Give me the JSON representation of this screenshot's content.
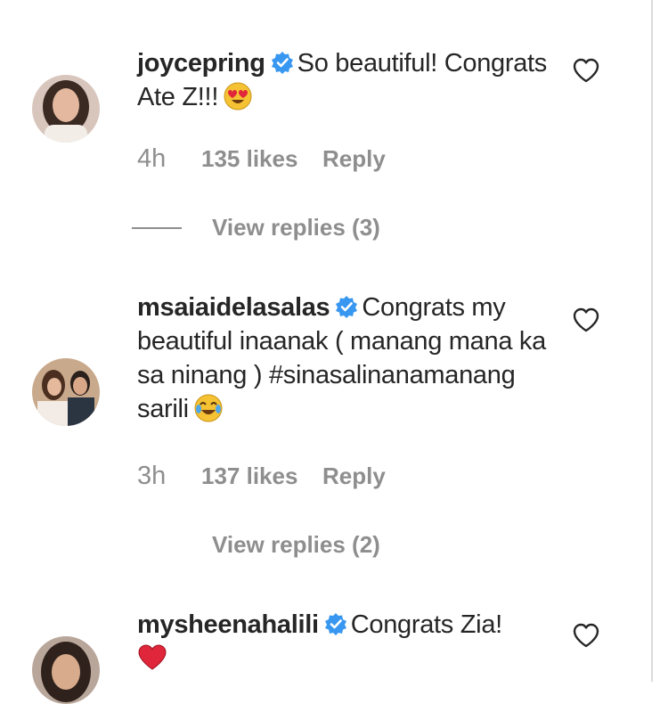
{
  "comments": [
    {
      "username": "joycepring",
      "verified": true,
      "text": "So beautiful! Congrats Ate Z!!!",
      "emoji": "heart-eyes-emoji",
      "time": "4h",
      "likes": "135 likes",
      "reply_label": "Reply",
      "view_replies": "View replies (3)"
    },
    {
      "username": "msaiaidelasalas",
      "verified": true,
      "text": "Congrats my beautiful inaanak ( manang mana ka sa ninang ) #sinasalinanamanang sarili",
      "emoji": "tears-of-joy-emoji",
      "time": "3h",
      "likes": "137 likes",
      "reply_label": "Reply",
      "view_replies": "View replies (2)"
    },
    {
      "username": "mysheenahalili",
      "verified": true,
      "text": "Congrats Zia!",
      "emoji": "red-heart-emoji"
    }
  ],
  "colors": {
    "text": "#262626",
    "muted": "#8e8e8e",
    "verified_blue": "#3897f0",
    "heart_red": "#ed4956"
  }
}
